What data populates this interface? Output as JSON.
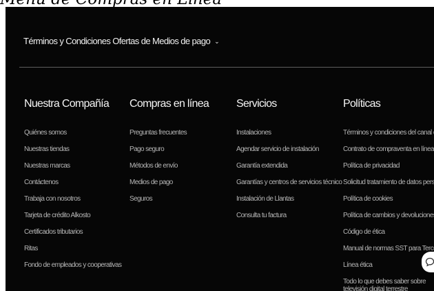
{
  "page_heading": "Menú de Compras en Línea",
  "terms_link": {
    "label": "Términos y Condiciones Ofertas de Medios de pago",
    "icon": "chevron-down-icon"
  },
  "columns": [
    {
      "heading": "Nuestra Compañía",
      "links": [
        "Quiénes somos",
        "Nuestras tiendas",
        "Nuestras marcas",
        "Contáctenos",
        "Trabaja con nosotros",
        "Tarjeta de crédito Alkosto",
        "Certificados tributarios",
        "Ritas",
        "Fondo de empleados y cooperativas"
      ]
    },
    {
      "heading": "Compras en línea",
      "links": [
        "Preguntas frecuentes",
        "Pago seguro",
        "Métodos de envío",
        "Medios de pago",
        "Seguros"
      ]
    },
    {
      "heading": "Servicios",
      "links": [
        "Instalaciones",
        "Agendar servicio de instalación",
        "Garantía extendida",
        "Garantías y centros de servicios técnico",
        "Instalación de Llantas",
        "Consulta tu factura"
      ]
    },
    {
      "heading": "Políticas",
      "links": [
        "Términos y condiciones del canal digital",
        "Contrato de compraventa en línea",
        "Política de privacidad",
        "Solicitud tratamiento de datos personales",
        "Política de cookies",
        "Política de cambios y devoluciones",
        "Código de ética",
        "Manual de normas SST para Terceros",
        "Línea ética",
        "Todo lo que debes saber sobre televisión digital terrestre"
      ]
    }
  ],
  "chat_widget": {
    "icon": "chat-icon"
  },
  "colors": {
    "footer_background": "#060606",
    "heading_text": "#f4f4f4",
    "link_text": "#b5b5b5"
  }
}
